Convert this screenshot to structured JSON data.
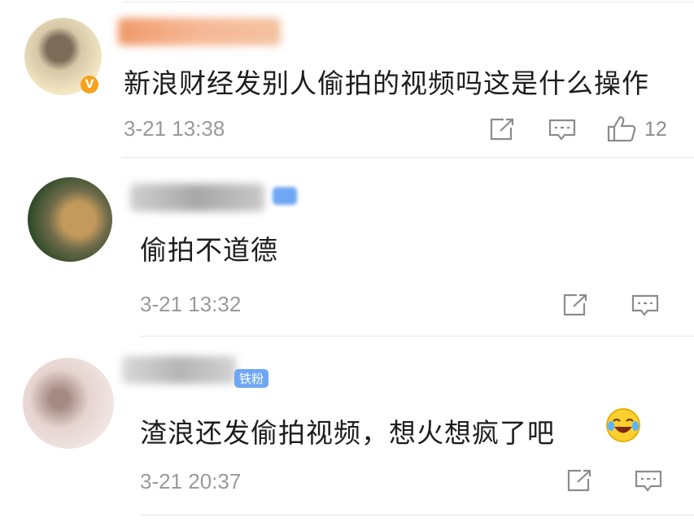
{
  "comments": [
    {
      "text": "新浪财经发别人偷拍的视频吗这是什么操作",
      "time": "3-21 13:38",
      "verified_badge": "V",
      "likes": "12",
      "avatar_colors": [
        "#f0e0b8",
        "#8f7e6a"
      ],
      "name_blur_color": "#f2a47a"
    },
    {
      "text": "偷拍不道德",
      "time": "3-21 13:32",
      "avatar_colors": [
        "#3f4a32",
        "#c4a36a"
      ],
      "name_blur_color": "#b9b9b9"
    },
    {
      "text": "渣浪还发偷拍视频，想火想疯了吧",
      "time": "3-21 20:37",
      "fan_badge": "铁粉",
      "avatar_colors": [
        "#e9d8d4",
        "#b78e88"
      ],
      "name_blur_color": "#c2c2c2"
    }
  ],
  "icons": {
    "share": "share-icon",
    "reply": "comment-icon",
    "like": "thumbs-up-icon",
    "emoji": "laughing-crying-emoji"
  },
  "colors": {
    "text": "#1d1d1d",
    "meta": "#9a9a9a",
    "icon": "#8c8c8c",
    "badge_blue": "#6fa7f5",
    "verified_orange": "#f7a21b"
  }
}
